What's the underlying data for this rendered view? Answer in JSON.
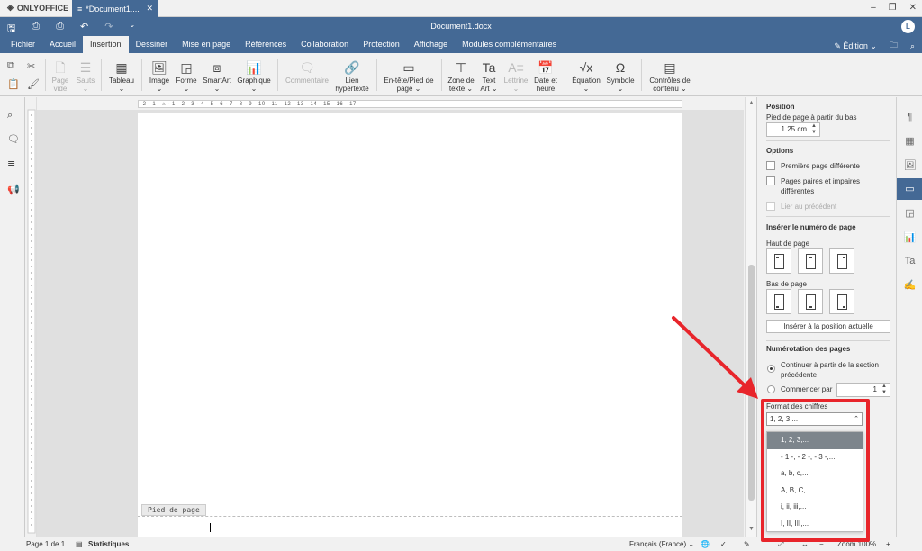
{
  "app": {
    "brand": "ONLYOFFICE",
    "tab_title": "*Document1....",
    "doc_title": "Document1.docx",
    "user_initial": "L"
  },
  "menu": {
    "tabs": [
      "Fichier",
      "Accueil",
      "Insertion",
      "Dessiner",
      "Mise en page",
      "Références",
      "Collaboration",
      "Protection",
      "Affichage",
      "Modules complémentaires"
    ],
    "active_tab": "Insertion",
    "edit_mode": "Édition"
  },
  "ribbon": {
    "page_vide_1": "Page",
    "page_vide_2": "vide",
    "sauts": "Sauts",
    "tableau": "Tableau",
    "image": "Image",
    "forme": "Forme",
    "smartart": "SmartArt",
    "graphique": "Graphique",
    "commentaire": "Commentaire",
    "lien_1": "Lien",
    "lien_2": "hypertexte",
    "entete_1": "En-tête/Pied de",
    "entete_2": "page",
    "zone_1": "Zone de",
    "zone_2": "texte",
    "textart_1": "Text",
    "textart_2": "Art",
    "lettrine": "Lettrine",
    "date_1": "Date et",
    "date_2": "heure",
    "equation": "Équation",
    "symbole": "Symbole",
    "controles_1": "Contrôles de",
    "controles_2": "contenu"
  },
  "ruler": {
    "marks": "· 2 · 1 · ⌂ · 1 · 2 · 3 · 4 · 5 · 6 · 7 · 8 · 9 · 10 · 11 · 12 · 13 · 14 · 15 · 16 · 17 ·"
  },
  "document": {
    "footer_label": "Pied de page"
  },
  "panel": {
    "position_title": "Position",
    "position_label": "Pied de page à partir du bas",
    "position_value": "1.25 cm",
    "options_title": "Options",
    "opt_first": "Première page différente",
    "opt_odd_even_1": "Pages paires et impaires",
    "opt_odd_even_2": "différentes",
    "opt_link": "Lier au précédent",
    "insert_title": "Insérer le numéro de page",
    "top_label": "Haut de page",
    "bottom_label": "Bas de page",
    "insert_current": "Insérer à la position actuelle",
    "numbering_title": "Numérotation des pages",
    "continue_1": "Continuer à partir de la section",
    "continue_2": "précédente",
    "start_at": "Commencer par",
    "start_value": "1",
    "format_label": "Format des chiffres",
    "format_value": "1, 2, 3,...",
    "format_options": [
      "1, 2, 3,...",
      "- 1 -, - 2 -, - 3 -,...",
      "a, b, c,...",
      "A, B, C,...",
      "i, ii, iii,...",
      "I, II, III,..."
    ]
  },
  "status": {
    "page": "Page 1 de 1",
    "stats": "Statistiques",
    "language": "Français (France)",
    "zoom": "Zoom 100%"
  },
  "colors": {
    "brand_blue": "#446995",
    "highlight_red": "#e8252b"
  }
}
